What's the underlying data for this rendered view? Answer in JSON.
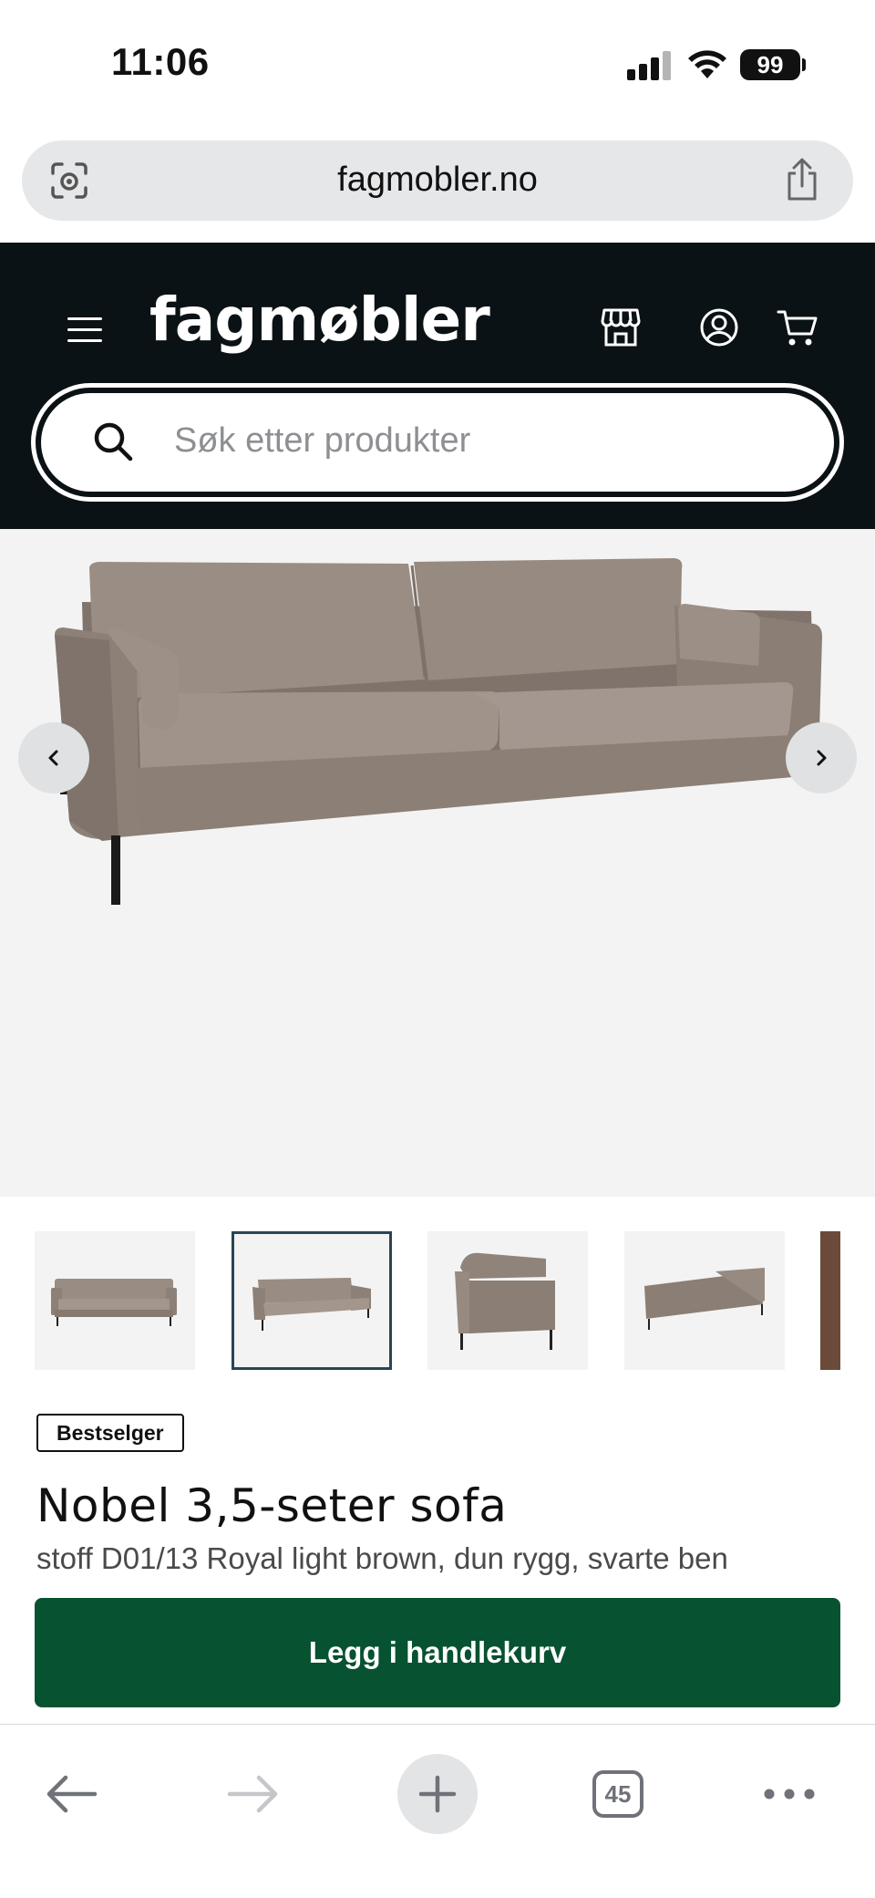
{
  "status_bar": {
    "time": "11:06",
    "battery": "99"
  },
  "browser": {
    "url": "fagmobler.no",
    "tabs_count": "45"
  },
  "header": {
    "logo": "fagmøbler",
    "search_placeholder": "Søk etter produkter"
  },
  "product": {
    "badge": "Bestselger",
    "title": "Nobel 3,5-seter sofa",
    "subtitle": "stoff D01/13 Royal light brown, dun rygg, svarte ben",
    "add_to_cart_label": "Legg i handlekurv",
    "gallery_active_index": 1
  },
  "colors": {
    "header_bg": "#0b1215",
    "cta_bg": "#075230",
    "sofa": "#8e8178",
    "hero_bg": "#f3f3f3"
  },
  "icons": [
    "lens-icon",
    "share-icon",
    "hamburger-icon",
    "store-icon",
    "account-icon",
    "cart-icon",
    "search-icon",
    "chevron-left-icon",
    "chevron-right-icon",
    "back-arrow-icon",
    "forward-arrow-icon",
    "plus-icon",
    "more-icon"
  ]
}
